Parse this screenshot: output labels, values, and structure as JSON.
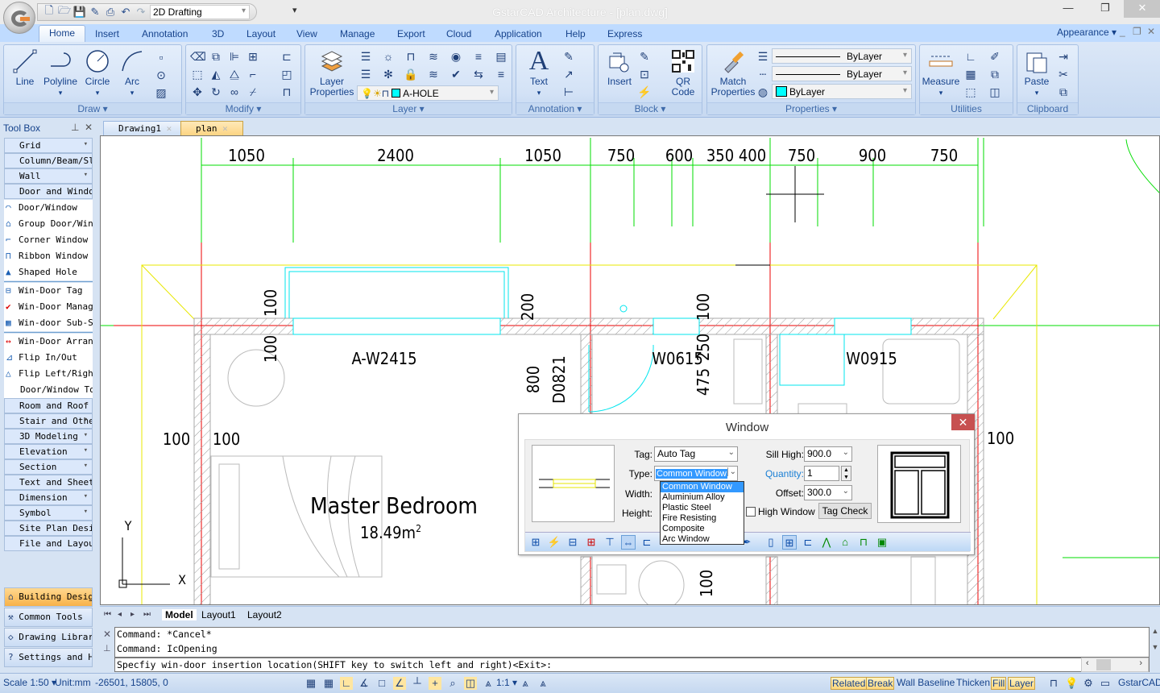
{
  "app": {
    "title": "GstarCAD Architecture - [plan.dwg]",
    "workspace": "2D Drafting"
  },
  "window_controls": {
    "minimize": "—",
    "restore": "❐",
    "close": "✕"
  },
  "ribbon_tabs": [
    "Home",
    "Insert",
    "Annotation",
    "3D",
    "Layout",
    "View",
    "Manage",
    "Export",
    "Cloud",
    "Application",
    "Help",
    "Express"
  ],
  "ribbon_right": {
    "appearance": "Appearance"
  },
  "ribbon": {
    "draw": {
      "label": "Draw",
      "buttons": [
        "Line",
        "Polyline",
        "Circle",
        "Arc"
      ]
    },
    "modify": {
      "label": "Modify"
    },
    "layer": {
      "label": "Layer",
      "properties_btn": "Layer Properties",
      "current_layer": "A-HOLE",
      "layer_color": "#00ffff"
    },
    "annotation": {
      "label": "Annotation",
      "text_btn": "Text"
    },
    "block": {
      "label": "Block",
      "insert_btn": "Insert",
      "qr_btn": "QR Code"
    },
    "properties": {
      "label": "Properties",
      "match_btn": "Match Properties",
      "lineweight": "ByLayer",
      "linetype": "ByLayer",
      "color": "ByLayer",
      "color_swatch": "#00ffff"
    },
    "utilities": {
      "label": "Utilities",
      "measure_btn": "Measure"
    },
    "clipboard": {
      "label": "Clipboard",
      "paste_btn": "Paste"
    }
  },
  "toolbox": {
    "title": "Tool Box",
    "top_categories": [
      "Grid",
      "Column/Beam/Slab",
      "Wall",
      "Door and Window"
    ],
    "items": [
      "Door/Window",
      "Group Door/Window",
      "Corner Window",
      "Ribbon Window",
      "Shaped Hole",
      "Win-Door Tag",
      "Win-Door Manage",
      "Win-door Sub-Sc",
      "Win-Door Arrang",
      "Flip In/Out",
      "Flip Left/Right",
      "Door/Window Tools"
    ],
    "categories": [
      "Room and Roof",
      "Stair and Other",
      "3D Modeling",
      "Elevation",
      "Section",
      "Text and Sheet",
      "Dimension",
      "Symbol",
      "Site Plan Design",
      "File and Layout"
    ],
    "bottom": [
      "Building Design",
      "Common Tools",
      "Drawing Library",
      "Settings and Help"
    ]
  },
  "doc_tabs": [
    "Drawing1",
    "plan"
  ],
  "drawing": {
    "top_dims": [
      "1050",
      "2400",
      "1050",
      "750",
      "600",
      "350",
      "400",
      "750",
      "900",
      "750"
    ],
    "left_dims": [
      "100",
      "100"
    ],
    "wall_dims": [
      "100",
      "100",
      "100"
    ],
    "side_dims": [
      "200",
      "800",
      "D0821",
      "100",
      "250",
      "475",
      "100"
    ],
    "window_tags": [
      "A-W2415",
      "W0615",
      "W0915"
    ],
    "room_name": "Master Bedroom",
    "room_area": "18.49m",
    "area_sup": "2",
    "ucs": {
      "x": "X",
      "y": "Y"
    }
  },
  "dialog": {
    "title": "Window",
    "tag_label": "Tag:",
    "tag_value": "Auto Tag",
    "type_label": "Type:",
    "type_value": "Common Window",
    "width_label": "Width:",
    "height_label": "Height:",
    "type_options": [
      "Common Window",
      "Aluminium Alloy",
      "Plastic Steel",
      "Fire Resisting",
      "Composite",
      "Arc Window"
    ],
    "sill_label": "Sill High:",
    "sill_value": "900.0",
    "quantity_label": "Quantity:",
    "quantity_value": "1",
    "offset_label": "Offset:",
    "offset_value": "300.0",
    "high_window_label": "High Window",
    "high_window_checked": false,
    "tag_check_btn": "Tag Check"
  },
  "layout_tabs": [
    "Model",
    "Layout1",
    "Layout2"
  ],
  "command": {
    "history": [
      "Command: *Cancel*",
      "Command: IcOpening"
    ],
    "prompt": "Specfiy win-door insertion location(SHIFT key to switch left and right)<Exit>:"
  },
  "status": {
    "scale": "Scale 1:50",
    "unit": "Unit:mm",
    "coords": "-26501, 15805, 0",
    "anno_scale": "1:1",
    "toggles": [
      {
        "label": "Related",
        "on": true
      },
      {
        "label": "Break",
        "on": true
      },
      {
        "label": "Wall Baseline",
        "on": false
      },
      {
        "label": "Thicken",
        "on": false
      },
      {
        "label": "Fill",
        "on": true
      },
      {
        "label": "Layer",
        "on": true
      }
    ],
    "brand": "GstarCAD"
  }
}
